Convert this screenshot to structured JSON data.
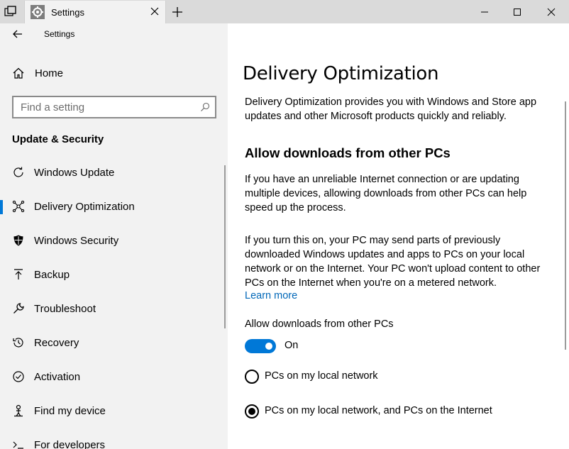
{
  "window": {
    "tab_title": "Settings"
  },
  "sidebar": {
    "app_title": "Settings",
    "home_label": "Home",
    "search_placeholder": "Find a setting",
    "section_title": "Update & Security",
    "items": [
      {
        "label": "Windows Update",
        "icon": "refresh-icon"
      },
      {
        "label": "Delivery Optimization",
        "icon": "network-nodes-icon",
        "selected": true
      },
      {
        "label": "Windows Security",
        "icon": "shield-icon"
      },
      {
        "label": "Backup",
        "icon": "upload-arrow-icon"
      },
      {
        "label": "Troubleshoot",
        "icon": "wrench-icon"
      },
      {
        "label": "Recovery",
        "icon": "history-icon"
      },
      {
        "label": "Activation",
        "icon": "check-circle-icon"
      },
      {
        "label": "Find my device",
        "icon": "person-locate-icon"
      },
      {
        "label": "For developers",
        "icon": "developer-icon"
      }
    ]
  },
  "main": {
    "title": "Delivery Optimization",
    "intro": "Delivery Optimization provides you with Windows and Store app updates and other Microsoft products quickly and reliably.",
    "subtitle": "Allow downloads from other PCs",
    "paragraph1": "If you have an unreliable Internet connection or are updating multiple devices, allowing downloads from other PCs can help speed up the process.",
    "paragraph2": "If you turn this on, your PC may send parts of previously downloaded Windows updates and apps to PCs on your local network or on the Internet. Your PC won't upload content to other PCs on the Internet when you're on a metered network.",
    "learn_more": "Learn more",
    "toggle_label": "Allow downloads from other PCs",
    "toggle_state": "On",
    "toggle_on": true,
    "radio_options": [
      {
        "label": "PCs on my local network",
        "selected": false
      },
      {
        "label": "PCs on my local network, and PCs on the Internet",
        "selected": true
      }
    ]
  },
  "colors": {
    "accent": "#0078d7",
    "link": "#0067b8",
    "sidebar_bg": "#f2f2f2",
    "titlebar_bg": "#dadada"
  }
}
